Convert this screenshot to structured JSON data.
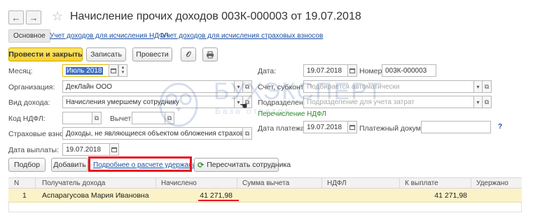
{
  "header": {
    "back_glyph": "←",
    "forward_glyph": "→",
    "title": "Начисление прочих доходов 003К-000003 от 19.07.2018"
  },
  "tabs": {
    "main": "Основное",
    "link1": "Учет доходов для исчисления НДФЛ",
    "link2": "Учет доходов для исчисления страховых взносов"
  },
  "toolbar": {
    "post_close": "Провести и закрыть",
    "save": "Записать",
    "post": "Провести"
  },
  "form": {
    "month_label": "Месяц:",
    "month_value": "Июль 2018",
    "date_label": "Дата:",
    "date_value": "19.07.2018",
    "number_label": "Номер:",
    "number_value": "003К-000003",
    "org_label": "Организация:",
    "org_value": "ДекЛайн ООО",
    "account_label": "Счет, субконто:",
    "account_placeholder": "Подбирается автоматически",
    "income_label": "Вид дохода:",
    "income_value": "Начисления умершему сотруднику",
    "division_label": "Подразделение:",
    "division_placeholder": "Подразделение для учета затрат",
    "ndfl_code_label": "Код НДФЛ:",
    "deduction_label": "Вычет:",
    "ndfl_transfer_text": "Перечисление НДФЛ",
    "insurance_label": "Страховые взносы:",
    "insurance_value": "Доходы, не являющиеся объектом обложения страховыми взнос",
    "pay_date_label": "Дата платежа:",
    "pay_date_value": "19.07.2018",
    "pay_doc_label": "Платежный документ:",
    "help_text": "?",
    "payout_date_label": "Дата выплаты:",
    "payout_date_value": "19.07.2018"
  },
  "table_toolbar": {
    "select": "Подбор",
    "add": "Добавить",
    "details_link": "Подробнее о расчете удержаний",
    "recalc": "Пересчитать сотрудника"
  },
  "table": {
    "columns": [
      "N",
      "Получатель дохода",
      "Начислено",
      "Сумма вычета",
      "НДФЛ",
      "К выплате",
      "Удержано"
    ],
    "rows": [
      {
        "n": "1",
        "recipient": "Аспарагусова Мария Ивановна",
        "accrued": "41 271,98",
        "deduction": "",
        "ndfl": "",
        "payout": "41 271,98",
        "withheld": ""
      }
    ]
  },
  "watermark": {
    "big": "БУХЭКСПЕРТ",
    "small": "База ответов"
  },
  "colors": {
    "primary_button": "#f7d32e",
    "link": "#1c4fa0",
    "highlight": "#e8121f",
    "selected_row": "#fbf2c8",
    "green_text": "#2a8a2a"
  }
}
